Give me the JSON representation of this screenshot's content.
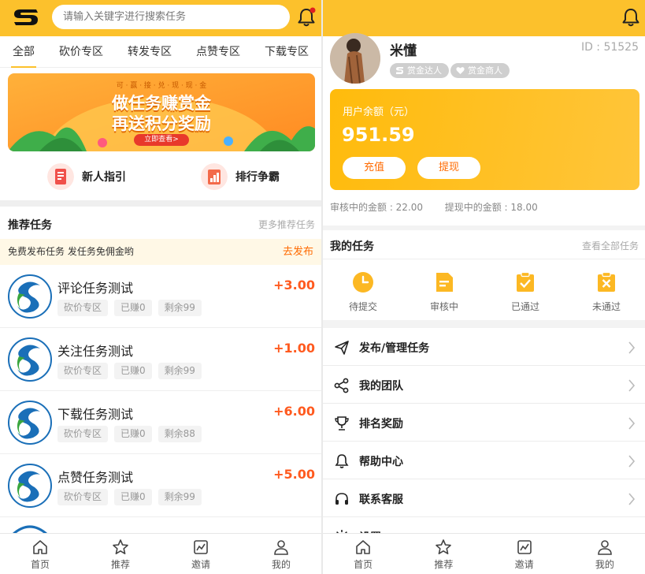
{
  "left": {
    "search_placeholder": "请输入关键字进行搜索任务",
    "tabs": [
      "全部",
      "砍价专区",
      "转发专区",
      "点赞专区",
      "下载专区"
    ],
    "banner": {
      "top_text": "可 · 赢 · 接 · 兑 · 现 · 现 · 金",
      "line1": "做任务赚赏金",
      "line2": "再送积分奖励",
      "cta": "立即查看>"
    },
    "quick": [
      "新人指引",
      "排行争霸"
    ],
    "section_title": "推荐任务",
    "section_more": "更多推荐任务",
    "notice": "免费发布任务 发任务免佣金哟",
    "notice_action": "去发布",
    "tasks": [
      {
        "name": "评论任务测试",
        "reward": "+3.00",
        "zone": "砍价专区",
        "earned": "已赚0",
        "left": "剩余99"
      },
      {
        "name": "关注任务测试",
        "reward": "+1.00",
        "zone": "砍价专区",
        "earned": "已赚0",
        "left": "剩余99"
      },
      {
        "name": "下载任务测试",
        "reward": "+6.00",
        "zone": "砍价专区",
        "earned": "已赚0",
        "left": "剩余88"
      },
      {
        "name": "点赞任务测试",
        "reward": "+5.00",
        "zone": "砍价专区",
        "earned": "已赚0",
        "left": "剩余99"
      }
    ],
    "tabbar": [
      "首页",
      "推荐",
      "邀请",
      "我的"
    ]
  },
  "right": {
    "username": "米懂",
    "user_id": "ID : 51525",
    "badges": [
      "赏金达人",
      "赏金商人"
    ],
    "balance_label": "用户余额（元）",
    "balance": "951.59",
    "recharge": "充值",
    "withdraw": "提现",
    "reviewing_amount": "审核中的金额 : 22.00",
    "withdrawing_amount": "提现中的金额 : 18.00",
    "my_tasks_title": "我的任务",
    "my_tasks_more": "查看全部任务",
    "task_states": [
      "待提交",
      "审核中",
      "已通过",
      "未通过"
    ],
    "menu": [
      "发布/管理任务",
      "我的团队",
      "排名奖励",
      "帮助中心",
      "联系客服",
      "设置"
    ],
    "tabbar": [
      "首页",
      "推荐",
      "邀请",
      "我的"
    ]
  },
  "colors": {
    "accent": "#fcc12c",
    "reward": "#ff5a1f",
    "action": "#ff6a00"
  }
}
